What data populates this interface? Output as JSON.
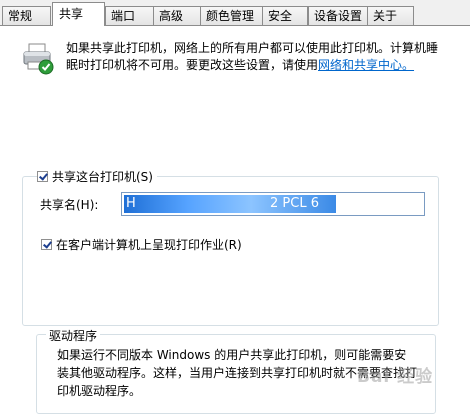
{
  "tabs": [
    {
      "label": "常规"
    },
    {
      "label": "共享"
    },
    {
      "label": "端口"
    },
    {
      "label": "高级"
    },
    {
      "label": "颜色管理"
    },
    {
      "label": "安全"
    },
    {
      "label": "设备设置"
    },
    {
      "label": "关于"
    }
  ],
  "active_tab": "共享",
  "info": {
    "text": "如果共享此打印机，网络上的所有用户都可以使用此打印机。计算机睡眠时打印机将不可用。要更改这些设置，请使用",
    "link": "网络和共享中心。"
  },
  "share": {
    "checkbox_label": "共享这台打印机(S)",
    "checked": true,
    "name_label": "共享名(H):",
    "name_value_start": "H",
    "name_value_end": "2 PCL 6",
    "render_checkbox_label": "在客户端计算机上呈现打印作业(R)",
    "render_checked": true
  },
  "drivers": {
    "title": "驱动程序",
    "text": "如果运行不同版本 Windows 的用户共享此打印机，则可能需要安装其他驱动程序。这样，当用户连接到共享打印机时就不需要查找打印机驱动程序。"
  },
  "icons": {
    "printer": "printer-shared-icon"
  }
}
